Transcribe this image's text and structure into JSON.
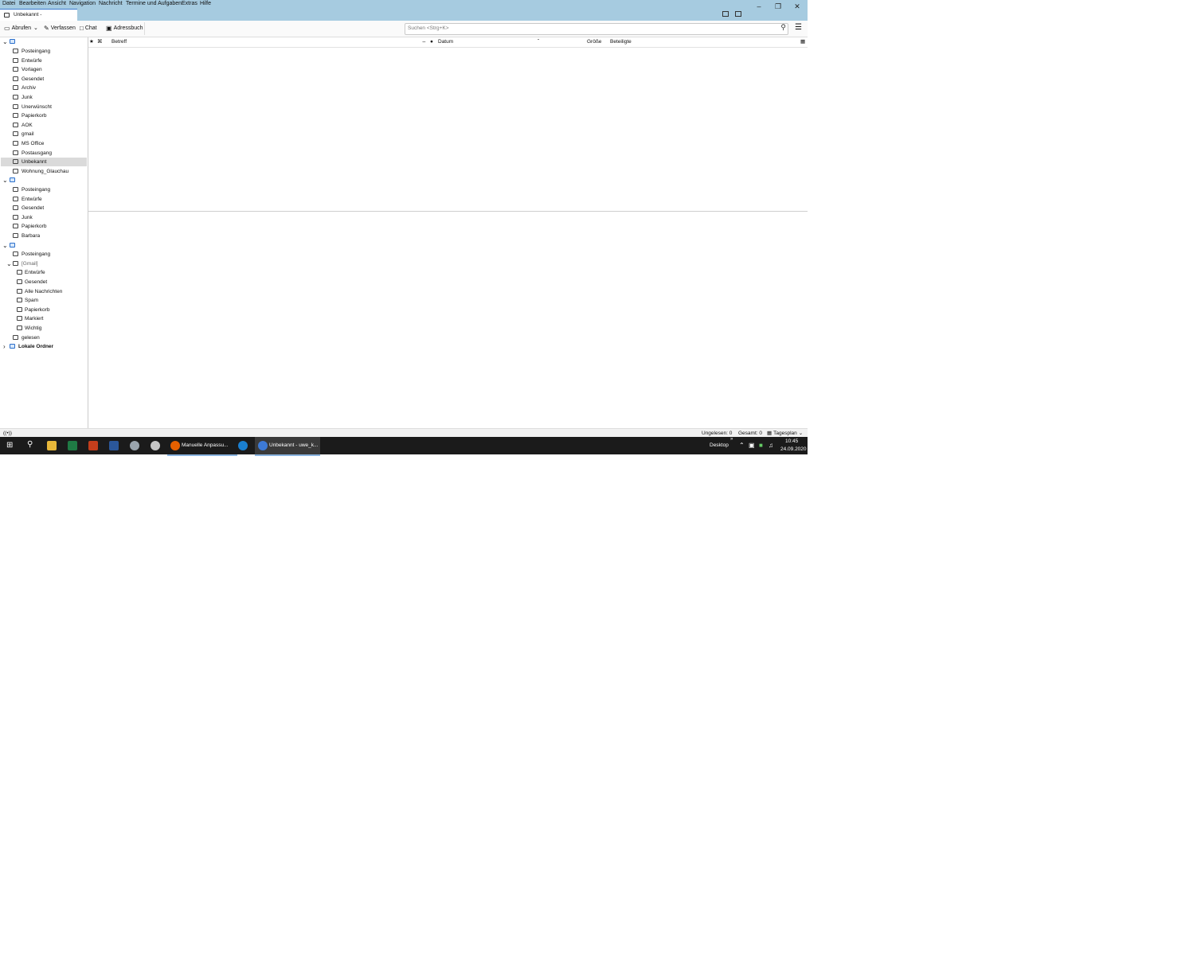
{
  "menubar": {
    "items": [
      "Datei",
      "Bearbeiten",
      "Ansicht",
      "Navigation",
      "Nachricht",
      "Termine und Aufgaben",
      "Extras",
      "Hilfe"
    ]
  },
  "tab": {
    "title": "Unbekannt - "
  },
  "toolbar": {
    "get_messages": "Abrufen",
    "compose": "Verfassen",
    "chat": "Chat",
    "address_book": "Adressbuch",
    "search_placeholder": "Suchen <Strg+K>"
  },
  "folders": {
    "account1_folders": [
      "Posteingang",
      "Entwürfe",
      "Vorlagen",
      "Gesendet",
      "Archiv",
      "Junk",
      "Unerwünscht",
      "Papierkorb",
      "AOK",
      "gmail",
      "MS Office",
      "Postausgang",
      "Unbekannt",
      "Wohnung_Glauchau"
    ],
    "account2_folders": [
      "Posteingang",
      "Entwürfe",
      "Gesendet",
      "Junk",
      "Papierkorb",
      "Barbara"
    ],
    "account3_inbox": "Posteingang",
    "gmail_group": "[Gmail]",
    "gmail_children": [
      "Entwürfe",
      "Gesendet",
      "Alle Nachrichten",
      "Spam",
      "Papierkorb",
      "Markiert",
      "Wichtig"
    ],
    "account3_other": "gelesen",
    "local_folders": "Lokale Ordner"
  },
  "columns": {
    "subject": "Betreff",
    "date": "Datum",
    "size": "Größe",
    "participants": "Beteiligte"
  },
  "statusbar": {
    "unread": "Ungelesen: 0",
    "total": "Gesamt: 0",
    "today_pane": "Tagesplan"
  },
  "taskbar": {
    "firefox_window": "Manuelle Anpassu...",
    "thunderbird_window": "Unbekannt - uwe_k...",
    "desktop": "Desktop",
    "time": "10:45",
    "date": "24.09.2020"
  },
  "colors": {
    "titlebar": "#a6cbe0",
    "accent": "#2a6fcc",
    "taskbar": "#1b1b1b"
  }
}
